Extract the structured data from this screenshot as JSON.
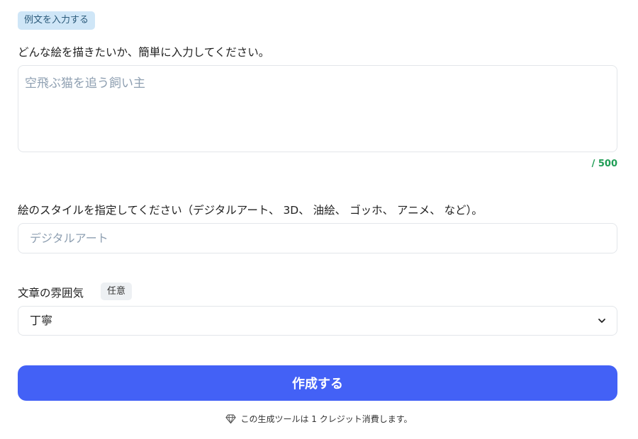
{
  "example_button": {
    "label": "例文を入力する"
  },
  "description": {
    "label": "どんな絵を描きたいか、簡単に入力してください。",
    "placeholder": "空飛ぶ猫を追う飼い主",
    "value": "",
    "counter": "/ 500"
  },
  "style": {
    "label": "絵のスタイルを指定してください（デジタルアート、 3D、 油絵、 ゴッホ、 アニメ、 など）。",
    "placeholder": "デジタルアート",
    "value": ""
  },
  "tone": {
    "label": "文章の雰囲気",
    "optional_badge": "任意",
    "selected": "丁寧",
    "icon": "chevron-down-icon"
  },
  "submit": {
    "label": "作成する"
  },
  "footer": {
    "icon": "diamond-icon",
    "note": "この生成ツールは 1 クレジット消費します。"
  },
  "colors": {
    "accent": "#4361f6",
    "counter": "#1f9d55",
    "badge_bg": "#cfe6f7",
    "optional_bg": "#edf0f3"
  }
}
